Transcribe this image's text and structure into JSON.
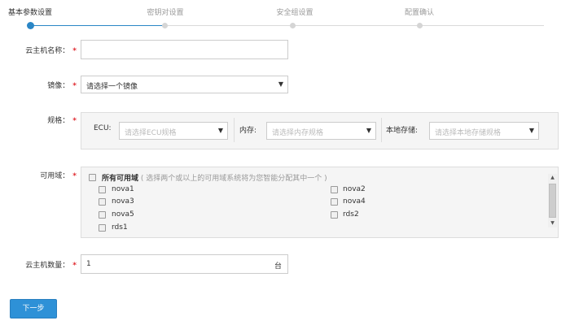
{
  "steps": [
    {
      "label": "基本参数设置",
      "state": "active"
    },
    {
      "label": "密钥对设置",
      "state": "pending"
    },
    {
      "label": "安全组设置",
      "state": "pending"
    },
    {
      "label": "配置确认",
      "state": "pending"
    }
  ],
  "form": {
    "required_mark": "*",
    "name": {
      "label": "云主机名称：",
      "value": ""
    },
    "image": {
      "label": "镜像：",
      "selected": "请选择一个镜像"
    },
    "spec": {
      "label": "规格：",
      "ecu": {
        "label": "ECU:",
        "placeholder": "请选择ECU规格"
      },
      "memory": {
        "label": "内存:",
        "placeholder": "请选择内存规格"
      },
      "storage": {
        "label": "本地存储:",
        "placeholder": "请选择本地存储规格"
      }
    },
    "zones": {
      "label": "可用域：",
      "all_label": "所有可用域",
      "all_hint": "( 选择两个或以上的可用域系统将为您智能分配其中一个 )",
      "items": [
        "nova1",
        "nova2",
        "nova3",
        "nova4",
        "nova5",
        "rds2",
        "rds1"
      ]
    },
    "count": {
      "label": "云主机数量：",
      "value": "1",
      "unit": "台"
    }
  },
  "buttons": {
    "next": "下一步"
  },
  "icons": {
    "dropdown": "caret-down-icon",
    "scroll_up": "scroll-up-arrow-icon",
    "scroll_down": "scroll-down-arrow-icon"
  },
  "colors": {
    "accent": "#2e91d7",
    "required": "#e0282e",
    "placeholder": "#bbbbbb"
  }
}
